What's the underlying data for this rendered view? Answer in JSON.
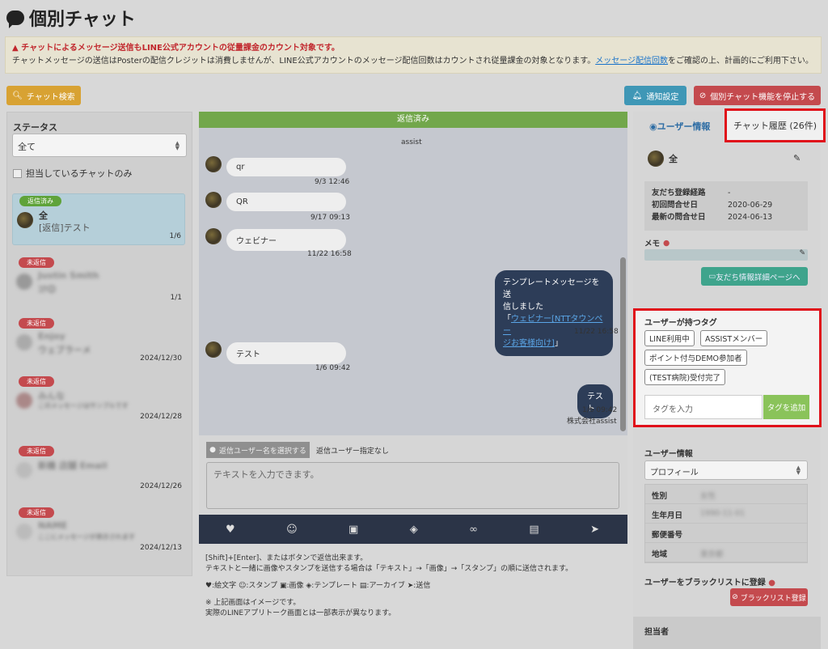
{
  "page": {
    "title": "個別チャット"
  },
  "notice": {
    "warn": "チャットによるメッセージ送信もLINE公式アカウントの従量課金のカウント対象です。",
    "body1": "チャットメッセージの送信はPosterの配信クレジットは消費しませんが、LINE公式アカウントのメッセージ配信回数はカウントされ従量課金の対象となります。",
    "link": "メッセージ配信回数",
    "body2": "をご確認の上、計画的にご利用下さい。"
  },
  "toolbar": {
    "search": "チャット検索",
    "notify": "通知設定",
    "stop": "個別チャット機能を停止する"
  },
  "left": {
    "status_label": "ステータス",
    "status_value": "全て",
    "only_mine": "担当しているチャットのみ",
    "conversations": [
      {
        "badge": "返信済み",
        "name": "全",
        "msg": "[返信]テスト",
        "meta": "1/6"
      },
      {
        "badge": "未返信",
        "name": "Justin Smith",
        "msg": "ｺｸ😊",
        "meta": "1/1"
      },
      {
        "badge": "未返信",
        "name": "Enjoy",
        "msg": "ウェブラーメ",
        "meta": "2024/12/30"
      },
      {
        "badge": "未返信",
        "name": "みんな",
        "msg": "このメッセージはサンプルです",
        "meta": "2024/12/28"
      },
      {
        "badge": "未返信",
        "name": "新機 店舗 Email",
        "msg": "",
        "meta": "2024/12/26"
      },
      {
        "badge": "未返信",
        "name": "NAME",
        "msg": "ここにメッセージが表示されます",
        "meta": "2024/12/13"
      }
    ]
  },
  "chat": {
    "header": "返信済み",
    "sender": "assist",
    "messages": [
      {
        "text": "qr",
        "time": "9/3 12:46"
      },
      {
        "text": "QR",
        "time": "9/17 09:13"
      },
      {
        "text": "ウェビナー",
        "time": "11/22 16:58"
      },
      {
        "text": "テスト",
        "time": "1/6 09:42"
      }
    ],
    "mine1": {
      "line1": "テンプレートメッセージを送",
      "line2": "信しました",
      "q1": "「",
      "link1": "ウェビナー[NTTタウンペー",
      "link2": "ジお客様向け]",
      "q2": "」",
      "time": "11/22 16:58"
    },
    "mine2": {
      "text": "テスト",
      "time": "1/6 09:42",
      "from": "株式会社assist"
    },
    "reply_user_btn": "返信ユーザー名を選択する",
    "reply_user_none": "返信ユーザー指定なし",
    "placeholder": "テキストを入力できます。"
  },
  "help": {
    "l1": "[Shift]+[Enter]、またはボタンで返信出来ます。",
    "l2": "テキストと一緒に画像やスタンプを送信する場合は「テキスト」→「画像」→「スタンプ」の順に送信されます。",
    "l3": "♥:絵文字 ☺:スタンプ ▣:画像 ◈:テンプレート ▤:アーカイブ ➤:送信",
    "l4": "※ 上記画面はイメージです。",
    "l5": "実際のLINEアプリトーク画面とは一部表示が異なります。"
  },
  "right": {
    "tab_user": "ユーザー情報",
    "tab_history": "チャット履歴 (26件)",
    "name": "全",
    "info": [
      {
        "k": "友だち登録経路",
        "v": "-"
      },
      {
        "k": "初回問合せ日",
        "v": "2020-06-29"
      },
      {
        "k": "最新の問合せ日",
        "v": "2024-06-13"
      }
    ],
    "memo": "メモ",
    "detail_btn": "友だち情報詳細ページへ",
    "tags_title": "ユーザーが持つタグ",
    "tags": [
      "LINE利用中",
      "ASSISTメンバー",
      "ポイント付与DEMO参加者",
      "(TEST病院)受付完了"
    ],
    "tag_placeholder": "タグを入力",
    "tag_add": "タグを追加",
    "user_info_title": "ユーザー情報",
    "profile": "プロフィール",
    "profile_rows": [
      {
        "k": "性別",
        "v": "女性"
      },
      {
        "k": "生年月日",
        "v": "1990-11-01"
      },
      {
        "k": "郵便番号",
        "v": ""
      },
      {
        "k": "地域",
        "v": "東京都"
      }
    ],
    "blacklist_title": "ユーザーをブラックリストに登録",
    "blacklist_btn": "ブラックリスト登録",
    "staff": "担当者"
  }
}
